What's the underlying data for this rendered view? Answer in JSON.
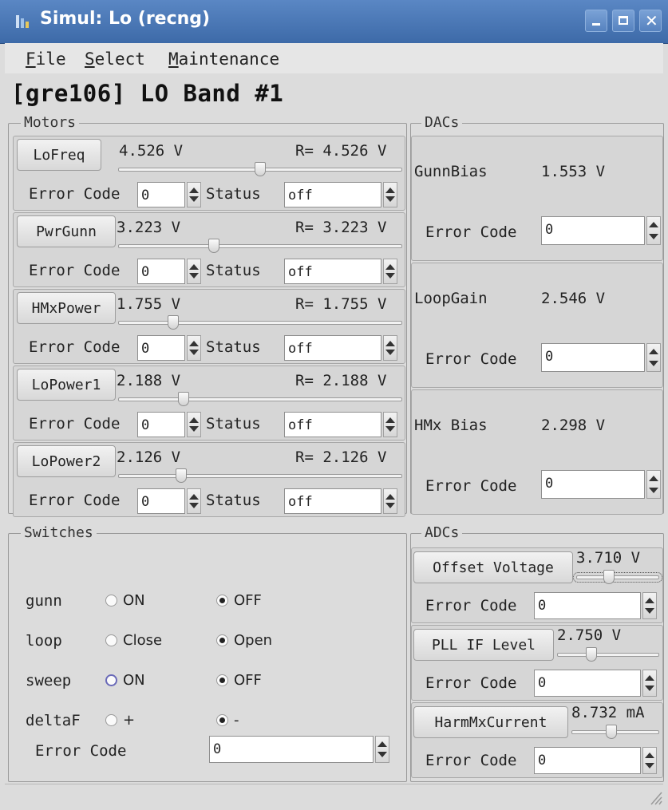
{
  "window": {
    "title": "Simul: Lo (recng)"
  },
  "menu": [
    {
      "mnemonic": "F",
      "rest": "ile"
    },
    {
      "mnemonic": "S",
      "rest": "elect"
    },
    {
      "mnemonic": "M",
      "rest": "aintenance"
    }
  ],
  "page_title": "[gre106] LO Band #1",
  "motors": {
    "title": "Motors",
    "error_label": "Error Code",
    "status_label": "Status",
    "items": [
      {
        "button": "LoFreq",
        "value": "4.526 V",
        "readback": "R= 4.526 V",
        "slider_fraction": 0.5,
        "error_code": "0",
        "status": "off"
      },
      {
        "button": "PwrGunn",
        "value": "3.223 V",
        "readback": "R= 3.223 V",
        "slider_fraction": 0.33,
        "error_code": "0",
        "status": "off"
      },
      {
        "button": "HMxPower",
        "value": "1.755 V",
        "readback": "R= 1.755 V",
        "slider_fraction": 0.18,
        "error_code": "0",
        "status": "off"
      },
      {
        "button": "LoPower1",
        "value": "2.188 V",
        "readback": "R= 2.188 V",
        "slider_fraction": 0.22,
        "error_code": "0",
        "status": "off"
      },
      {
        "button": "LoPower2",
        "value": "2.126 V",
        "readback": "R= 2.126 V",
        "slider_fraction": 0.21,
        "error_code": "0",
        "status": "off"
      }
    ]
  },
  "dacs": {
    "title": "DACs",
    "error_label": "Error Code",
    "items": [
      {
        "name": "GunnBias",
        "value": "1.553 V",
        "error_code": "0"
      },
      {
        "name": "LoopGain",
        "value": "2.546 V",
        "error_code": "0"
      },
      {
        "name": "HMx Bias",
        "value": "2.298 V",
        "error_code": "0"
      }
    ]
  },
  "switches": {
    "title": "Switches",
    "error_label": "Error Code",
    "error_code": "0",
    "rows": [
      {
        "name": "gunn",
        "opt1": "ON",
        "opt2": "OFF",
        "selected": 2
      },
      {
        "name": "loop",
        "opt1": "Close",
        "opt2": "Open",
        "selected": 2
      },
      {
        "name": "sweep",
        "opt1": "ON",
        "opt2": "OFF",
        "selected": 2
      },
      {
        "name": "deltaF",
        "opt1": "+",
        "opt2": "-",
        "selected": 2
      }
    ]
  },
  "adcs": {
    "title": "ADCs",
    "error_label": "Error Code",
    "items": [
      {
        "button": "Offset Voltage",
        "value": "3.710 V",
        "slider_fraction": 0.38,
        "error_code": "0"
      },
      {
        "button": "PLL IF Level",
        "value": "2.750 V",
        "slider_fraction": 0.32,
        "error_code": "0"
      },
      {
        "button": "HarmMxCurrent",
        "value": "8.732 mA",
        "slider_fraction": 0.45,
        "error_code": "0"
      }
    ]
  },
  "colors": {
    "titlebar": "#3d6aa8",
    "title_text": "#ffffff",
    "focus_radio": "#6a6ab8"
  },
  "icons": {
    "app": "app-icon",
    "minimize": "minimize-icon",
    "maximize": "maximize-icon",
    "close": "close-icon",
    "resize": "resize-grip-icon"
  }
}
